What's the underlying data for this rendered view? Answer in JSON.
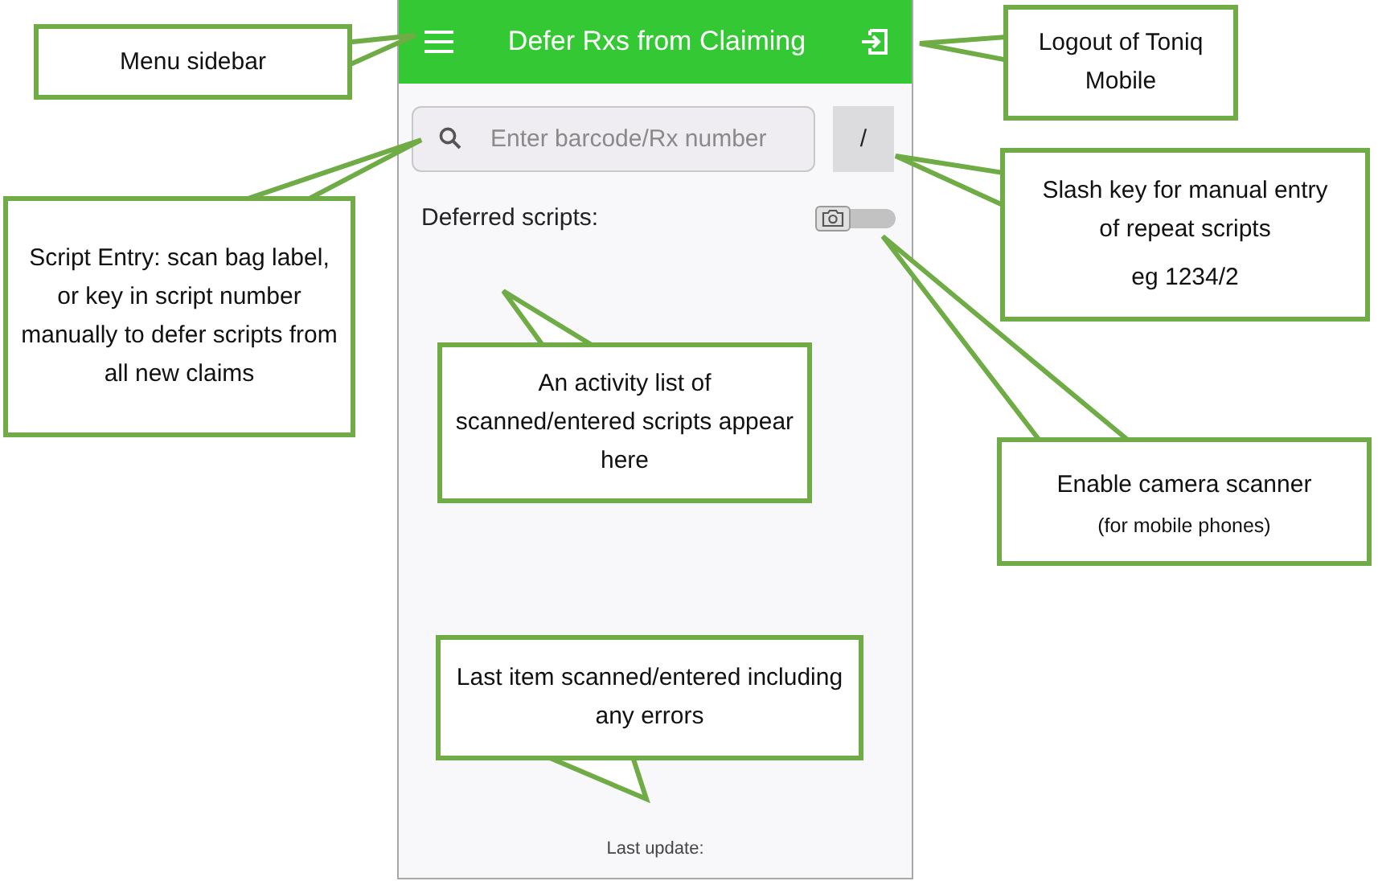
{
  "app_bar": {
    "title": "Defer Rxs from Claiming"
  },
  "search": {
    "placeholder": "Enter barcode/Rx number"
  },
  "slash_key": {
    "label": "/"
  },
  "deferred": {
    "label": "Deferred scripts:",
    "camera_scanner": {
      "on": false
    }
  },
  "footer": {
    "label": "Last update:"
  },
  "callouts": [
    {
      "texts": [
        {
          "kind": "main",
          "text": "Menu sidebar"
        }
      ]
    },
    {
      "texts": [
        {
          "kind": "main",
          "text": "Logout of Toniq Mobile"
        }
      ]
    },
    {
      "texts": [
        {
          "kind": "main",
          "text": "Script Entry: scan bag label, or key in script number manually to defer scripts from all new claims"
        }
      ]
    },
    {
      "texts": [
        {
          "kind": "main",
          "text": "Slash key for manual entry of repeat scripts"
        },
        {
          "kind": "main",
          "text": "eg 1234/2"
        }
      ]
    },
    {
      "texts": [
        {
          "kind": "main",
          "text": "Enable camera scanner"
        },
        {
          "kind": "note",
          "text": "(for mobile phones)"
        }
      ]
    },
    {
      "texts": [
        {
          "kind": "main",
          "text": "An activity list of scanned/entered scripts appear here"
        }
      ]
    },
    {
      "texts": [
        {
          "kind": "main",
          "text": "Last item scanned/entered including any errors"
        }
      ]
    }
  ]
}
